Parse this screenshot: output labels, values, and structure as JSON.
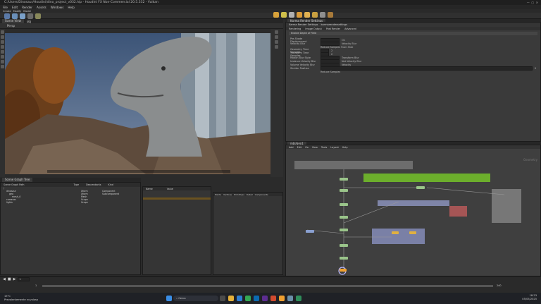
{
  "window": {
    "title": "C:/Users/Dinosaur/Houdini/dino_project_v032.hip - Houdini FX Non-Commercial 20.5.332 - Vulkan"
  },
  "menu": [
    "File",
    "Edit",
    "Render",
    "Assets",
    "Windows",
    "Help"
  ],
  "shelf_tabs": [
    "Create",
    "Modify",
    "Model",
    "Polygon",
    "Deform",
    "Texture",
    "Rigging",
    "Characters"
  ],
  "viewport": {
    "tab_label": "Scene View",
    "path_label": "obj",
    "camera_label": "Persp"
  },
  "properties": {
    "tab_label": "Karma Render Settings",
    "node_name": "karmarendersettings",
    "tabs": [
      "Rendering",
      "Image Output",
      "Post Render",
      "Advanced"
    ],
    "section": "Enable Depth of Field",
    "rows": [
      {
        "label": "Pre-Shade Displacement",
        "value": "On"
      },
      {
        "label": "Velocity Blur",
        "value": "Velocity Blur"
      },
      {
        "label": "",
        "value": "Reduce Samples From Hide"
      },
      {
        "label": "Geometry Time Samples",
        "value": "2"
      },
      {
        "label": "Transform Time Samples",
        "value": "2"
      },
      {
        "label": "Motion Blur Style",
        "value": "Transform Blur"
      },
      {
        "label": "Instance Velocity Blur",
        "value": "Not Velocity Blur"
      },
      {
        "label": "Volume Velocity Blur",
        "value": "Velocity"
      },
      {
        "label": "Shutter Position",
        "value": "0"
      },
      {
        "label": "",
        "value": "Reduce Samples"
      }
    ]
  },
  "network": {
    "tab_label": "/obj/geo1",
    "path_label": "obj",
    "menu": [
      "Add",
      "Edit",
      "Go",
      "View",
      "Tools",
      "Layout",
      "Help"
    ],
    "context_label": "Geometry"
  },
  "scene_tree": {
    "tab_label": "Scene Graph Tree",
    "columns": [
      "Scene Graph Path",
      "Type",
      "Descendants",
      "Kind"
    ],
    "rows": [
      {
        "name": "/",
        "type": "",
        "kind": ""
      },
      {
        "name": "dinosaur",
        "type": "Xform",
        "kind": "Component"
      },
      {
        "name": "geo",
        "type": "Xform",
        "kind": "Subcomponent"
      },
      {
        "name": "mesh_0",
        "type": "Mesh",
        "kind": ""
      },
      {
        "name": "cameras",
        "type": "Scope",
        "kind": ""
      },
      {
        "name": "lights",
        "type": "Scope",
        "kind": ""
      }
    ]
  },
  "scene_details": {
    "tab_label": "Scene Graph Details",
    "columns": [
      "Name",
      "Value"
    ]
  },
  "geometry_spreadsheet": {
    "tabs": [
      "Points",
      "Vertices",
      "Primitives",
      "Detail",
      "Components"
    ]
  },
  "timeline": {
    "frame": "1",
    "start": "1",
    "end": "240"
  },
  "taskbar": {
    "weather": "19°C",
    "weather_desc": "Prevalentemente nuvoloso",
    "search_placeholder": "Cerca",
    "time": "18:23",
    "date": "05/05/2025"
  },
  "colors": {
    "accent": "#f0a030",
    "green_node": "#6cae2c",
    "selected_node": "#b7b7ff"
  }
}
